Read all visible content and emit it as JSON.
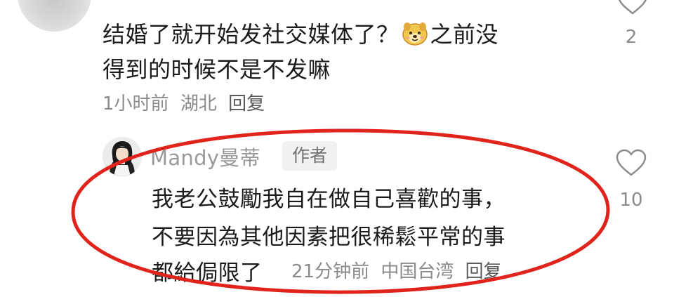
{
  "comment1": {
    "line1_part1": "结婚了就开始发社交媒体了？",
    "emoji": "dog-face-emoji",
    "line1_part2": "之前没",
    "line2": "得到的时候不是不发嘛",
    "time": "1小时前",
    "location": "湖北",
    "reply_label": "回复",
    "like_count": "2"
  },
  "comment2": {
    "username": "Mandy曼蒂",
    "badge": "作者",
    "line1": "我老公鼓勵我自在做自己喜歡的事，",
    "line2": "不要因為其他因素把很稀鬆平常的事",
    "line3": "都給侷限了",
    "time": "21分钟前",
    "location": "中国台湾",
    "reply_label": "回复",
    "like_count": "10"
  },
  "colors": {
    "highlight_ellipse": "#e0241b",
    "meta_text": "#8a8a8a",
    "main_text": "#1b1b1b"
  },
  "icons": [
    "heart-outline-icon",
    "dog-face-emoji",
    "avatar-image"
  ]
}
